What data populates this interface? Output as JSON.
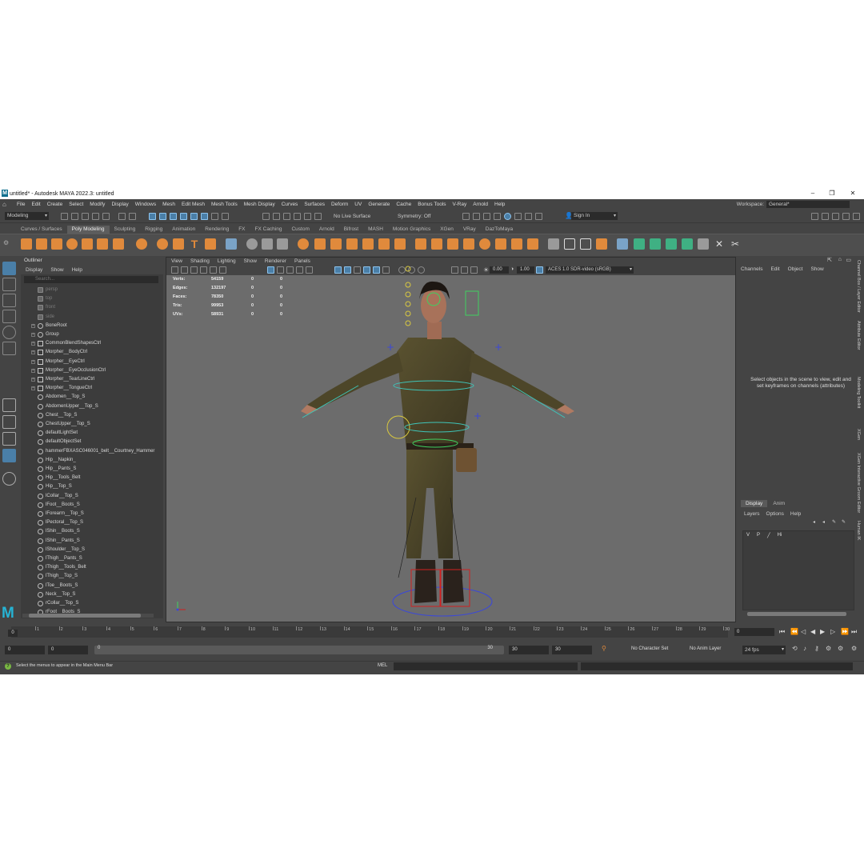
{
  "titlebar": {
    "title": "untitled* - Autodesk MAYA 2022.3: untitled",
    "min": "–",
    "max": "❐",
    "close": "✕"
  },
  "menubar": {
    "items": [
      "File",
      "Edit",
      "Create",
      "Select",
      "Modify",
      "Display",
      "Windows",
      "Mesh",
      "Edit Mesh",
      "Mesh Tools",
      "Mesh Display",
      "Curves",
      "Surfaces",
      "Deform",
      "UV",
      "Generate",
      "Cache",
      "Bonus Tools",
      "V-Ray",
      "Arnold",
      "Help"
    ],
    "workspace_label": "Workspace:",
    "workspace_value": "General*"
  },
  "statusline": {
    "mode": "Modeling",
    "live_surface": "No Live Surface",
    "symmetry": "Symmetry: Off",
    "sign_in": "Sign In"
  },
  "shelf": {
    "tabs": [
      "Curves / Surfaces",
      "Poly Modeling",
      "Sculpting",
      "Rigging",
      "Animation",
      "Rendering",
      "FX",
      "FX Caching",
      "Custom",
      "Arnold",
      "Bifrost",
      "MASH",
      "Motion Graphics",
      "XGen",
      "VRay",
      "DazToMaya"
    ],
    "active_tab": "Poly Modeling"
  },
  "outliner": {
    "title": "Outliner",
    "menu": [
      "Display",
      "Show",
      "Help"
    ],
    "search_placeholder": "Search...",
    "items": [
      {
        "label": "persp",
        "kind": "cam",
        "dim": true
      },
      {
        "label": "top",
        "kind": "cam",
        "dim": true
      },
      {
        "label": "front",
        "kind": "cam",
        "dim": true
      },
      {
        "label": "side",
        "kind": "cam",
        "dim": true
      },
      {
        "label": "BoneRoot",
        "kind": "joint",
        "expand": true
      },
      {
        "label": "Group",
        "kind": "joint",
        "expand": true
      },
      {
        "label": "CommonBlendShapesCtrl",
        "kind": "grp",
        "expand": true
      },
      {
        "label": "Morpher__BodyCtrl",
        "kind": "grp",
        "expand": true
      },
      {
        "label": "Morpher__EyeCtrl",
        "kind": "grp",
        "expand": true
      },
      {
        "label": "Morpher__EyeOcclusionCtrl",
        "kind": "grp",
        "expand": true
      },
      {
        "label": "Morpher__TearLineCtrl",
        "kind": "grp",
        "expand": true
      },
      {
        "label": "Morpher__TongueCtrl",
        "kind": "grp",
        "expand": true
      },
      {
        "label": "Abdomen__Top_S",
        "kind": "set"
      },
      {
        "label": "AbdomenUpper__Top_S",
        "kind": "set"
      },
      {
        "label": "Chest__Top_S",
        "kind": "set"
      },
      {
        "label": "ChestUpper__Top_S",
        "kind": "set"
      },
      {
        "label": "defaultLightSet",
        "kind": "set"
      },
      {
        "label": "defaultObjectSet",
        "kind": "set"
      },
      {
        "label": "hammerFBXASC046001_belt__Courtney_Hammer",
        "kind": "set"
      },
      {
        "label": "Hip__Napkin_",
        "kind": "set"
      },
      {
        "label": "Hip__Pants_S",
        "kind": "set"
      },
      {
        "label": "Hip__Tools_Belt",
        "kind": "set"
      },
      {
        "label": "Hip__Top_S",
        "kind": "set"
      },
      {
        "label": "lCollar__Top_S",
        "kind": "set"
      },
      {
        "label": "lFoot__Boots_S",
        "kind": "set"
      },
      {
        "label": "lForearm__Top_S",
        "kind": "set"
      },
      {
        "label": "lPectoral__Top_S",
        "kind": "set"
      },
      {
        "label": "lShin__Boots_S",
        "kind": "set"
      },
      {
        "label": "lShin__Pants_S",
        "kind": "set"
      },
      {
        "label": "lShoulder__Top_S",
        "kind": "set"
      },
      {
        "label": "lThigh__Pants_S",
        "kind": "set"
      },
      {
        "label": "lThigh__Tools_Belt",
        "kind": "set"
      },
      {
        "label": "lThigh__Top_S",
        "kind": "set"
      },
      {
        "label": "lToe__Boots_S",
        "kind": "set"
      },
      {
        "label": "Neck__Top_S",
        "kind": "set"
      },
      {
        "label": "rCollar__Top_S",
        "kind": "set"
      },
      {
        "label": "rFoot__Boots_S",
        "kind": "set"
      }
    ]
  },
  "viewport": {
    "menu": [
      "View",
      "Shading",
      "Lighting",
      "Show",
      "Renderer",
      "Panels"
    ],
    "exposure": "0.00",
    "gamma": "1.00",
    "color_space": "ACES 1.0 SDR-video (sRGB)",
    "hud": [
      {
        "label": "Verts:",
        "a": "54159",
        "b": "0",
        "c": "0"
      },
      {
        "label": "Edges:",
        "a": "132197",
        "b": "0",
        "c": "0"
      },
      {
        "label": "Faces:",
        "a": "78350",
        "b": "0",
        "c": "0"
      },
      {
        "label": "Tris:",
        "a": "99953",
        "b": "0",
        "c": "0"
      },
      {
        "label": "UVs:",
        "a": "58931",
        "b": "0",
        "c": "0"
      }
    ]
  },
  "channelbox": {
    "menu": [
      "Channels",
      "Edit",
      "Object",
      "Show"
    ],
    "message": "Select objects in the scene to view, edit and set keyframes on channels (attributes)"
  },
  "layers": {
    "tabs": [
      "Display",
      "Anim"
    ],
    "active_tab": "Display",
    "menu": [
      "Layers",
      "Options",
      "Help"
    ],
    "row": {
      "v": "V",
      "p": "P",
      "name": "Hi"
    }
  },
  "sidetabs": [
    "Channel Box / Layer Editor",
    "Attribute Editor",
    "Modeling Toolkit",
    "XGen",
    "XGen Interactive Groom Editor",
    "Human IK"
  ],
  "timeline": {
    "ticks": [
      "1",
      "2",
      "3",
      "4",
      "5",
      "6",
      "7",
      "8",
      "9",
      "10",
      "11",
      "12",
      "13",
      "14",
      "15",
      "16",
      "17",
      "18",
      "19",
      "20",
      "21",
      "22",
      "23",
      "24",
      "25",
      "26",
      "27",
      "28",
      "29",
      "30"
    ],
    "current_frame": "0",
    "current_field": "0"
  },
  "range": {
    "start": "0",
    "anim_start": "0",
    "slider_start": "0",
    "slider_end": "30",
    "anim_end": "30",
    "end": "30",
    "character_set": "No Character Set",
    "anim_layer": "No Anim Layer",
    "fps": "24 fps"
  },
  "helpline": {
    "text": "Select the menus to appear in the Main Menu Bar",
    "mel": "MEL"
  },
  "colors": {
    "accent": "#4a7fa8",
    "shelf_orange": "#e08a3c",
    "shelf_green": "#3fb083",
    "viewport_bg": "#6c6c6c",
    "maya_blue": "#26b3d4"
  }
}
